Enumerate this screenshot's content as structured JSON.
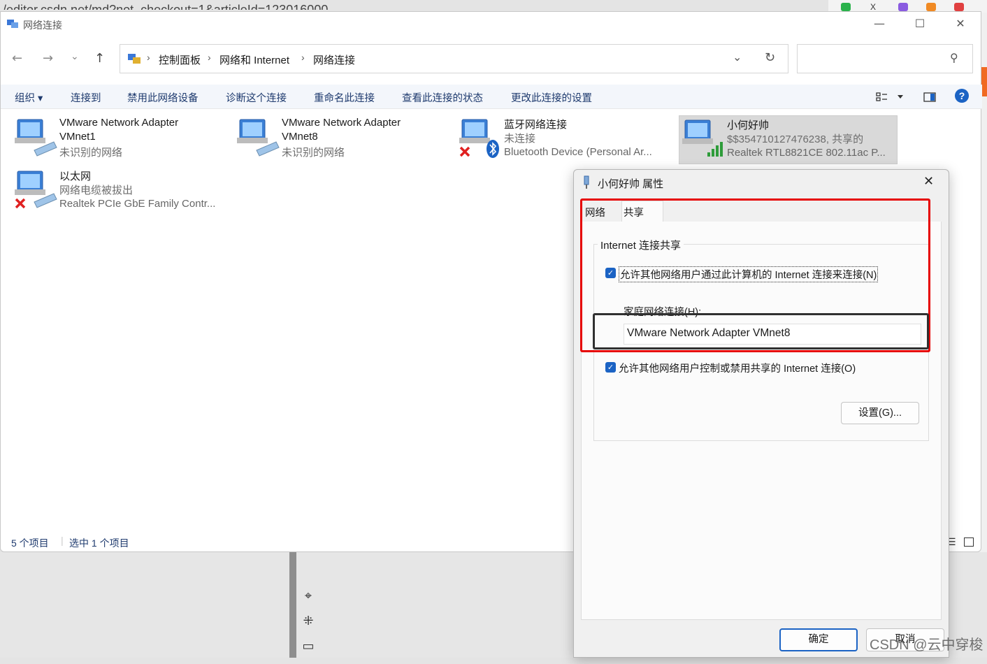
{
  "browser": {
    "url_fragment": "/editor.csdn.net/md?not_checkout=1&articleId=123016000"
  },
  "window": {
    "title": "网络连接",
    "minimize": "—",
    "maximize": "☐",
    "close": "✕"
  },
  "nav": {
    "back": "←",
    "forward": "→",
    "recent": "⌄",
    "up": "↑",
    "breadcrumb": [
      "控制面板",
      "网络和 Internet",
      "网络连接"
    ],
    "breadcrumb_sep": "›",
    "dropdown": "⌄",
    "refresh": "↻",
    "search_placeholder": "",
    "search_icon": "⚲"
  },
  "commands": {
    "organize": "组织 ▾",
    "connect_to": "连接到",
    "disable": "禁用此网络设备",
    "diagnose": "诊断这个连接",
    "rename": "重命名此连接",
    "view_status": "查看此连接的状态",
    "change_settings": "更改此连接的设置",
    "help": "?"
  },
  "items": [
    {
      "name_line1": "VMware Network Adapter",
      "name_line2": "VMnet1",
      "status": "未识别的网络",
      "device": ""
    },
    {
      "name_line1": "VMware Network Adapter",
      "name_line2": "VMnet8",
      "status": "未识别的网络",
      "device": ""
    },
    {
      "name_line1": "蓝牙网络连接",
      "name_line2": "",
      "status": "未连接",
      "device": "Bluetooth Device (Personal Ar..."
    },
    {
      "name_line1": "小何好帅",
      "name_line2": "",
      "status": "$$354710127476238, 共享的",
      "device": "Realtek RTL8821CE 802.11ac P..."
    },
    {
      "name_line1": "以太网",
      "name_line2": "",
      "status": "网络电缆被拔出",
      "device": "Realtek PCIe GbE Family Contr..."
    }
  ],
  "statusbar": {
    "count": "5 个项目",
    "selected": "选中 1 个项目"
  },
  "dialog": {
    "title": "小何好帅 属性",
    "close": "✕",
    "tabs": [
      "网络",
      "共享"
    ],
    "group_title": "Internet 连接共享",
    "allow_share": "允许其他网络用户通过此计算机的 Internet 连接来连接(N)",
    "home_label": "家庭网络连接(H):",
    "home_value": "VMware Network Adapter VMnet8",
    "allow_control": "允许其他网络用户控制或禁用共享的 Internet 连接(O)",
    "settings_button": "设置(G)...",
    "ok_button": "确定",
    "cancel_button": "取消"
  },
  "watermark": "CSDN @云中穿梭",
  "colors": {
    "accent": "#1b63c4",
    "annotation_red": "#e60000",
    "selection": "#d9d9d9"
  }
}
